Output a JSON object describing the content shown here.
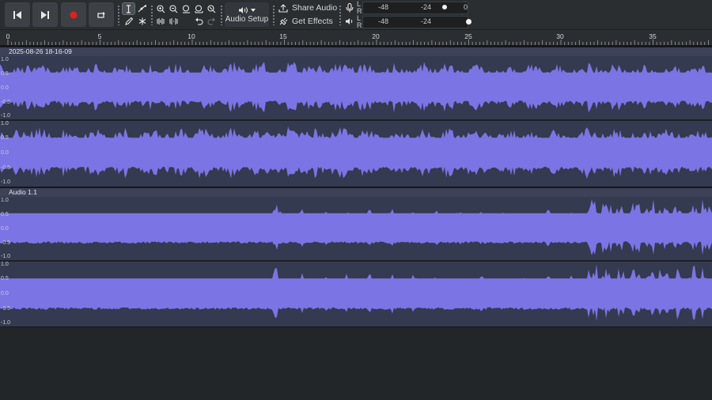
{
  "toolbar": {
    "audio_setup_label": "Audio Setup",
    "share_audio_label": "Share Audio",
    "get_effects_label": "Get Effects",
    "record_meter": {
      "channels": [
        "L",
        "R"
      ],
      "ticks": [
        "-48",
        "-24",
        "0"
      ]
    },
    "playback_meter": {
      "channels": [
        "L",
        "R"
      ],
      "ticks": [
        "-48",
        "-24"
      ]
    }
  },
  "timeline": {
    "ruler_labels": [
      "0",
      "5",
      "10",
      "15",
      "20",
      "25",
      "30",
      "35"
    ]
  },
  "tracks": [
    {
      "clip_name": "2025-08-26 18-16-09",
      "channels": [
        {
          "scale_labels": [
            "1.0",
            "0.5",
            "0.0",
            "-0.5",
            "-1.0"
          ]
        },
        {
          "scale_labels": [
            "1.0",
            "0.5",
            "0.0",
            "-0.5",
            "-1.0"
          ]
        }
      ]
    },
    {
      "clip_name": "Audio 1.1",
      "channels": [
        {
          "scale_labels": [
            "1.0",
            "0.5",
            "0.0",
            "-0.5",
            "-1.0"
          ]
        },
        {
          "scale_labels": [
            "1.0",
            "0.5",
            "0.0",
            "-0.5",
            "-1.0"
          ]
        }
      ]
    }
  ],
  "colors": {
    "waveform": "#7b74e4",
    "track_bg": "#343a4f",
    "record": "#e01f1f"
  }
}
